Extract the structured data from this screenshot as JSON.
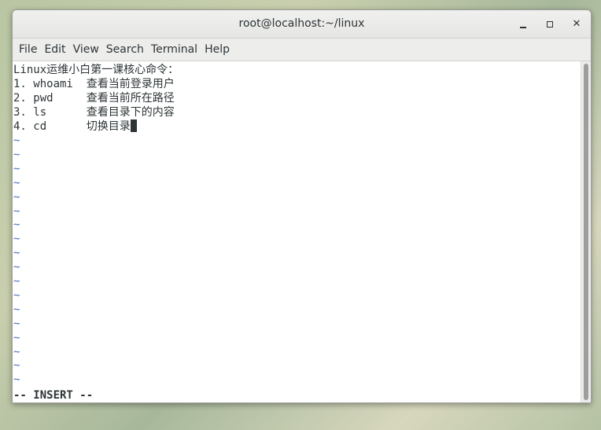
{
  "window": {
    "title": "root@localhost:~/linux",
    "minimize_label": "–",
    "maximize_label": "□",
    "close_label": "✕"
  },
  "menu": {
    "items": [
      "File",
      "Edit",
      "View",
      "Search",
      "Terminal",
      "Help"
    ]
  },
  "editor": {
    "lines": [
      "Linux运维小白第一课核心命令：",
      "1. whoami  查看当前登录用户",
      "2. pwd     查看当前所在路径",
      "3. ls      查看目录下的内容",
      "4. cd      切换目录"
    ],
    "tilde": "~",
    "status": "-- INSERT --"
  },
  "colors": {
    "tilde": "#4a6fb5",
    "text": "#2e3436",
    "background": "#ffffff"
  }
}
